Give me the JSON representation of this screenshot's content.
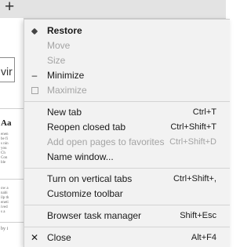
{
  "background": {
    "new_tab_icon": "plus-icon",
    "fragments": [
      "vir",
      "Aa",
      "by i"
    ]
  },
  "menu": {
    "items": [
      {
        "label": "Restore",
        "shortcut": "",
        "icon": "restore-icon",
        "disabled": false,
        "bold": true
      },
      {
        "label": "Move",
        "shortcut": "",
        "icon": "",
        "disabled": true,
        "bold": false
      },
      {
        "label": "Size",
        "shortcut": "",
        "icon": "",
        "disabled": true,
        "bold": false
      },
      {
        "label": "Minimize",
        "shortcut": "",
        "icon": "minimize-icon",
        "disabled": false,
        "bold": false
      },
      {
        "label": "Maximize",
        "shortcut": "",
        "icon": "maximize-icon",
        "disabled": true,
        "bold": false
      },
      {
        "label": "New tab",
        "shortcut": "Ctrl+T",
        "icon": "",
        "disabled": false,
        "bold": false
      },
      {
        "label": "Reopen closed tab",
        "shortcut": "Ctrl+Shift+T",
        "icon": "",
        "disabled": false,
        "bold": false
      },
      {
        "label": "Add open pages to favorites",
        "shortcut": "Ctrl+Shift+D",
        "icon": "",
        "disabled": true,
        "bold": false
      },
      {
        "label": "Name window...",
        "shortcut": "",
        "icon": "",
        "disabled": false,
        "bold": false
      },
      {
        "label": "Turn on vertical tabs",
        "shortcut": "Ctrl+Shift+,",
        "icon": "",
        "disabled": false,
        "bold": false
      },
      {
        "label": "Customize toolbar",
        "shortcut": "",
        "icon": "",
        "disabled": false,
        "bold": false
      },
      {
        "label": "Browser task manager",
        "shortcut": "Shift+Esc",
        "icon": "",
        "disabled": false,
        "bold": false
      },
      {
        "label": "Close",
        "shortcut": "Alt+F4",
        "icon": "close-icon",
        "disabled": false,
        "bold": false
      }
    ]
  }
}
